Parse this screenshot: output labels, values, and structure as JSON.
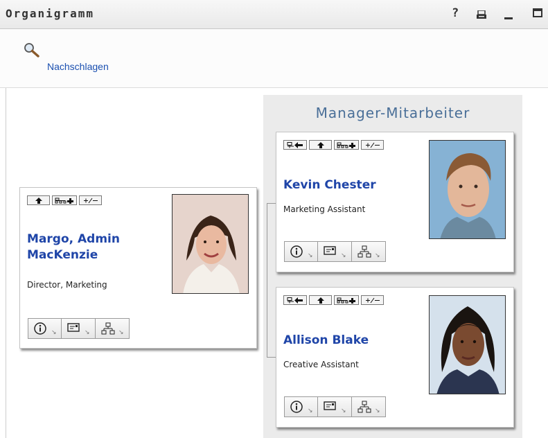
{
  "header": {
    "title": "Organigramm",
    "icons": [
      "help-icon",
      "print-icon",
      "minimize-icon",
      "maximize-icon"
    ]
  },
  "toolbar": {
    "lookup_label": "Nachschlagen",
    "lookup_icon": "magnifier-icon"
  },
  "group": {
    "title": "Manager-Mitarbeiter"
  },
  "people": {
    "manager": {
      "name_line1": "Margo, Admin",
      "name_line2": "MacKenzie",
      "title": "Director, Marketing",
      "toolbar_buttons": [
        "up-arrow-icon",
        "org-expand-icon",
        "toggle-plus-minus-icon"
      ],
      "actions": [
        "info-icon",
        "email-icon",
        "org-chart-icon"
      ]
    },
    "reports": [
      {
        "name": "Kevin Chester",
        "title": "Marketing Assistant",
        "toolbar_buttons": [
          "show-manager-icon",
          "up-arrow-icon",
          "org-expand-icon",
          "toggle-plus-minus-icon"
        ],
        "actions": [
          "info-icon",
          "email-icon",
          "org-chart-icon"
        ]
      },
      {
        "name": "Allison Blake",
        "title": "Creative Assistant",
        "toolbar_buttons": [
          "show-manager-icon",
          "up-arrow-icon",
          "org-expand-icon",
          "toggle-plus-minus-icon"
        ],
        "actions": [
          "info-icon",
          "email-icon",
          "org-chart-icon"
        ]
      }
    ]
  },
  "colors": {
    "link_blue": "#1f45a8",
    "group_title": "#4a6f98",
    "panel_bg": "#ebebeb"
  }
}
